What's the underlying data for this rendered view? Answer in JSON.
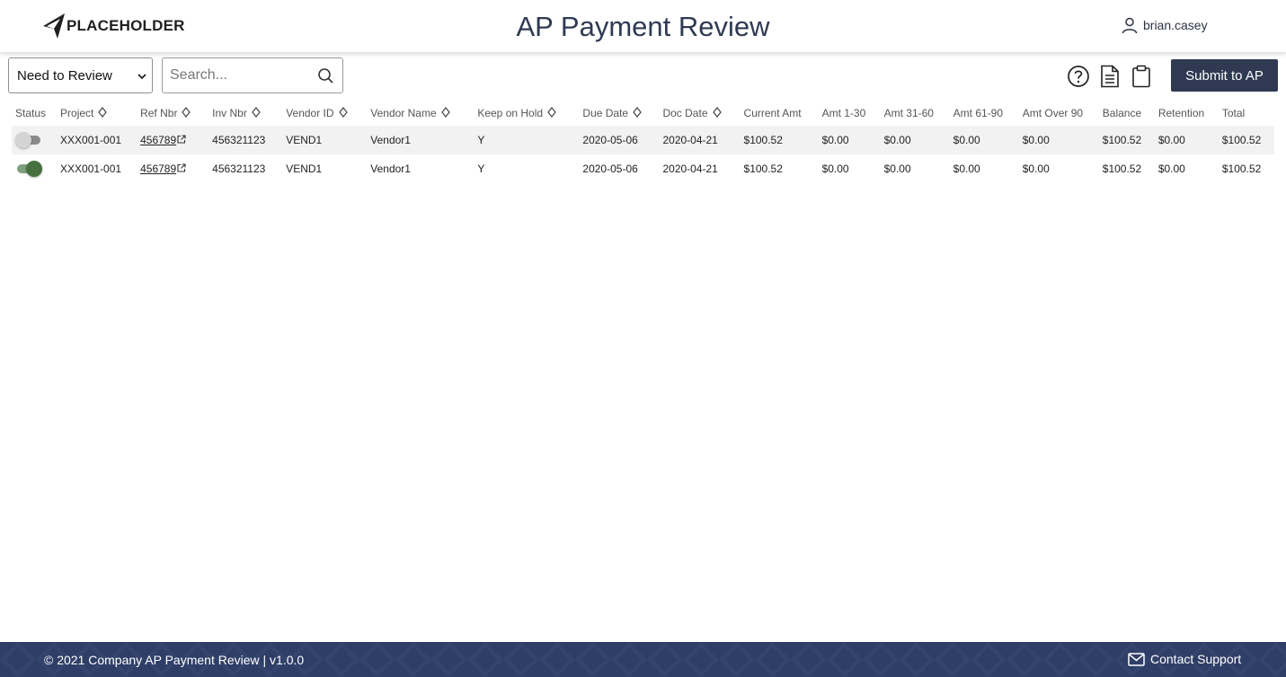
{
  "header": {
    "logo_text": "PLACEHOLDER",
    "title": "AP Payment Review",
    "username": "brian.casey"
  },
  "toolbar": {
    "filter_selected": "Need to Review",
    "search_placeholder": "Search...",
    "submit_label": "Submit to AP",
    "icons": [
      "help-icon",
      "document-icon",
      "clipboard-icon"
    ]
  },
  "table": {
    "columns": [
      "Status",
      "Project",
      "Ref Nbr",
      "Inv Nbr",
      "Vendor ID",
      "Vendor Name",
      "Keep on Hold",
      "Due Date",
      "Doc Date",
      "Current Amt",
      "Amt 1-30",
      "Amt 31-60",
      "Amt 61-90",
      "Amt Over 90",
      "Balance",
      "Retention",
      "Total"
    ],
    "rows": [
      {
        "status": "off",
        "project": "XXX001-001",
        "ref_nbr": "456789",
        "inv_nbr": "456321123",
        "vendor_id": "VEND1",
        "vendor_name": "Vendor1",
        "keep_on_hold": "Y",
        "due_date": "2020-05-06",
        "doc_date": "2020-04-21",
        "current_amt": "$100.52",
        "amt_1_30": "$0.00",
        "amt_31_60": "$0.00",
        "amt_61_90": "$0.00",
        "amt_over_90": "$0.00",
        "balance": "$100.52",
        "retention": "$0.00",
        "total": "$100.52"
      },
      {
        "status": "on",
        "project": "XXX001-001",
        "ref_nbr": "456789",
        "inv_nbr": "456321123",
        "vendor_id": "VEND1",
        "vendor_name": "Vendor1",
        "keep_on_hold": "Y",
        "due_date": "2020-05-06",
        "doc_date": "2020-04-21",
        "current_amt": "$100.52",
        "amt_1_30": "$0.00",
        "amt_31_60": "$0.00",
        "amt_61_90": "$0.00",
        "amt_over_90": "$0.00",
        "balance": "$100.52",
        "retention": "$0.00",
        "total": "$100.52"
      }
    ]
  },
  "footer": {
    "copyright": "© 2021 Company AP Payment Review | v1.0.0",
    "contact_label": "Contact Support"
  },
  "colors": {
    "navy": "#2f3a52",
    "footer_bg": "#2f3e66",
    "toggle_on": "#46713f",
    "row_stripe": "#f2f2f2"
  }
}
